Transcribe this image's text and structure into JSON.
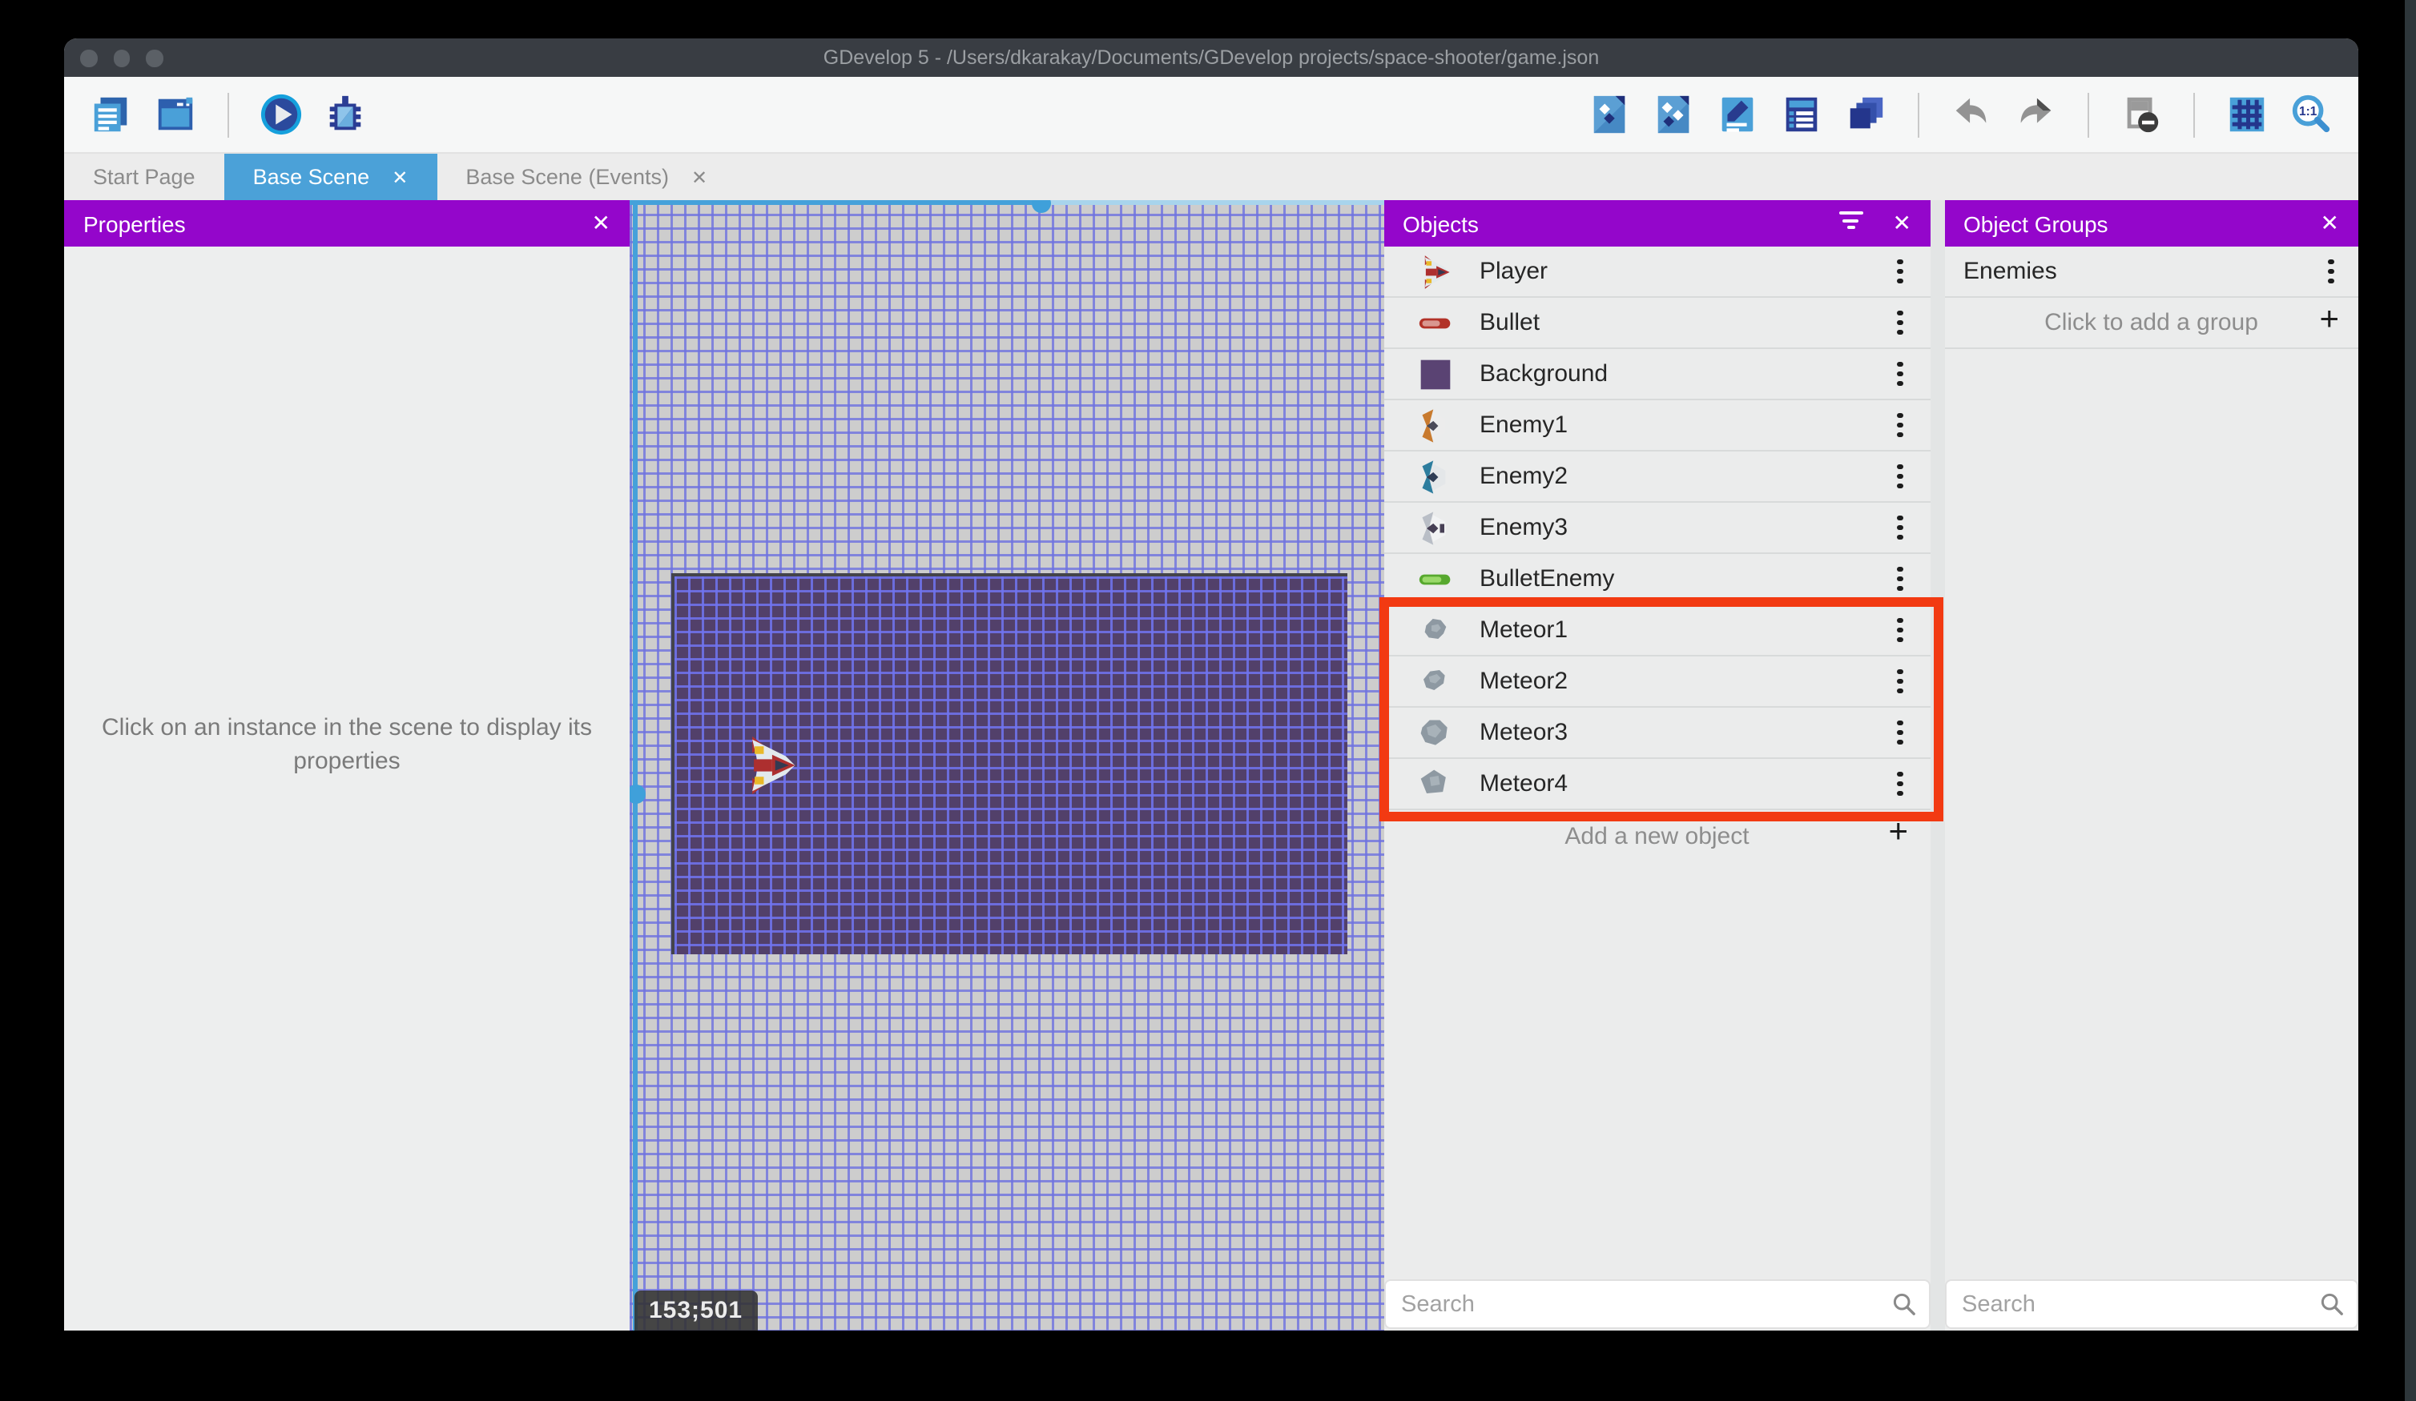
{
  "window": {
    "title": "GDevelop 5 - /Users/dkarakay/Documents/GDevelop projects/space-shooter/game.json"
  },
  "icons": {
    "close": "✕",
    "plus": "+"
  },
  "tabs": [
    {
      "label": "Start Page"
    },
    {
      "label": "Base Scene"
    },
    {
      "label": "Base Scene (Events)"
    }
  ],
  "toolbar": {
    "left_icons": [
      "project-manager",
      "start-page-window",
      "play",
      "debug"
    ],
    "right_icons": [
      "add-object",
      "edit-object-groups",
      "edit-scene-properties",
      "open-properties",
      "open-layers",
      "undo",
      "redo",
      "toggle-instances-mask",
      "toggle-grid",
      "zoom-original"
    ]
  },
  "properties": {
    "title": "Properties",
    "empty_message": "Click on an instance in the scene to display its properties"
  },
  "scene": {
    "coordinates": "153;501"
  },
  "objects": {
    "title": "Objects",
    "items": [
      {
        "name": "Player"
      },
      {
        "name": "Bullet"
      },
      {
        "name": "Background"
      },
      {
        "name": "Enemy1"
      },
      {
        "name": "Enemy2"
      },
      {
        "name": "Enemy3"
      },
      {
        "name": "BulletEnemy"
      },
      {
        "name": "Meteor1"
      },
      {
        "name": "Meteor2"
      },
      {
        "name": "Meteor3"
      },
      {
        "name": "Meteor4"
      }
    ],
    "add_label": "Add a new object",
    "search_placeholder": "Search"
  },
  "object_groups": {
    "title": "Object Groups",
    "groups": [
      {
        "name": "Enemies"
      }
    ],
    "add_label": "Click to add a group",
    "search_placeholder": "Search"
  },
  "colors": {
    "header_purple": "#9406cb",
    "active_tab_blue": "#4ba1d8",
    "highlight_red": "#f23a12",
    "scene_background_object": "#52406a",
    "titlebar": "#393d43"
  }
}
